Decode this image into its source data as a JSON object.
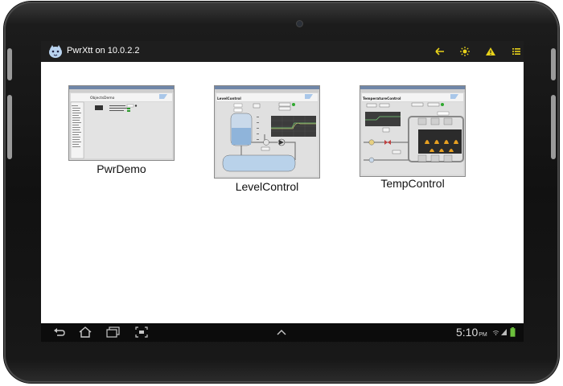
{
  "window": {
    "app_title": "PwrXtt on 10.0.2.2"
  },
  "action_bar": {
    "icons": [
      "back-arrow-icon",
      "sun-icon",
      "warning-icon",
      "list-icon"
    ],
    "colors": {
      "background": "#1e1e1e",
      "accent": "#e8d21a"
    }
  },
  "graphs": [
    {
      "label": "PwrDemo",
      "thumb_title": "ObjectsDemo",
      "icon": "pwrdemo-thumbnail"
    },
    {
      "label": "LevelControl",
      "thumb_title": "LevelControl",
      "icon": "levelcontrol-thumbnail"
    },
    {
      "label": "TempControl",
      "thumb_title": "TemperatureControl",
      "icon": "tempcontrol-thumbnail"
    }
  ],
  "status_bar": {
    "time": "5:10",
    "time_suffix": "PM",
    "icons": [
      "back-icon",
      "home-icon",
      "recent-apps-icon",
      "screenshot-icon",
      "menu-up-icon",
      "wifi-icon",
      "signal-icon",
      "battery-icon"
    ]
  }
}
